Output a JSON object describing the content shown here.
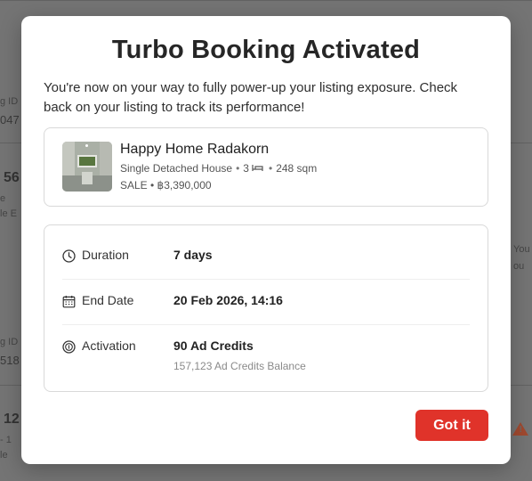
{
  "background": {
    "fragments": [
      {
        "text": "g ID"
      },
      {
        "text": "047"
      },
      {
        "text": "56"
      },
      {
        "text": "e"
      },
      {
        "text": "le  E"
      },
      {
        "text": "g ID"
      },
      {
        "text": "518"
      },
      {
        "text": "12"
      },
      {
        "text": "- 1"
      },
      {
        "text": "le"
      },
      {
        "text": "You"
      },
      {
        "text": "ou"
      }
    ],
    "warning_color": "#a0492f"
  },
  "modal": {
    "title": "Turbo Booking Activated",
    "description": "You're now on your way to fully power-up your listing exposure. Check back on your listing to track its performance!",
    "listing": {
      "name": "Happy Home Radakorn",
      "property_type": "Single Detached House",
      "bedrooms": "3",
      "area": "248 sqm",
      "price": "SALE • ฿3,390,000",
      "separator": "•"
    },
    "details": {
      "duration": {
        "label": "Duration",
        "value": "7 days",
        "icon": "clock-icon"
      },
      "end_date": {
        "label": "End Date",
        "value": "20 Feb 2026, 14:16",
        "icon": "calendar-icon"
      },
      "activation": {
        "label": "Activation",
        "value": "90 Ad Credits",
        "sub": "157,123 Ad Credits Balance",
        "icon": "coin-icon"
      }
    },
    "button_label": "Got it",
    "accent_color": "#e0332a"
  }
}
